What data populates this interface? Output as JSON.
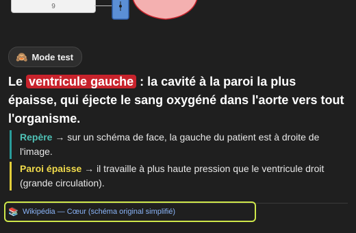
{
  "figure": {
    "answer_value": "9"
  },
  "mode_badge": {
    "icon": "see-no-evil-monkey-icon",
    "icon_glyph": "🙈",
    "label": "Mode test"
  },
  "headline": {
    "prefix": "Le",
    "term": "ventricule gauche",
    "text": ": la cavité à la paroi la plus épaisse, qui éjecte le sang oxygéné dans l'aorte vers tout l'organisme."
  },
  "notes": [
    {
      "title": "Repère",
      "arrow": "→",
      "text": "sur un schéma de face, la gauche du patient est à droite de l'image."
    },
    {
      "title": "Paroi épaisse",
      "arrow": "→",
      "text": "il travaille à plus haute pression que le ventricule droit (grande circulation)."
    }
  ],
  "source": {
    "icon": "book-icon",
    "icon_glyph": "📚",
    "label": "Wikipédia — Cœur (schéma original simplifié)"
  },
  "colors": {
    "term_highlight": "#c8232c",
    "note_1_accent": "#2a9d9b",
    "note_2_accent": "#e3cf3a",
    "source_outline": "#cfe84a",
    "link": "#8ab4f8"
  }
}
